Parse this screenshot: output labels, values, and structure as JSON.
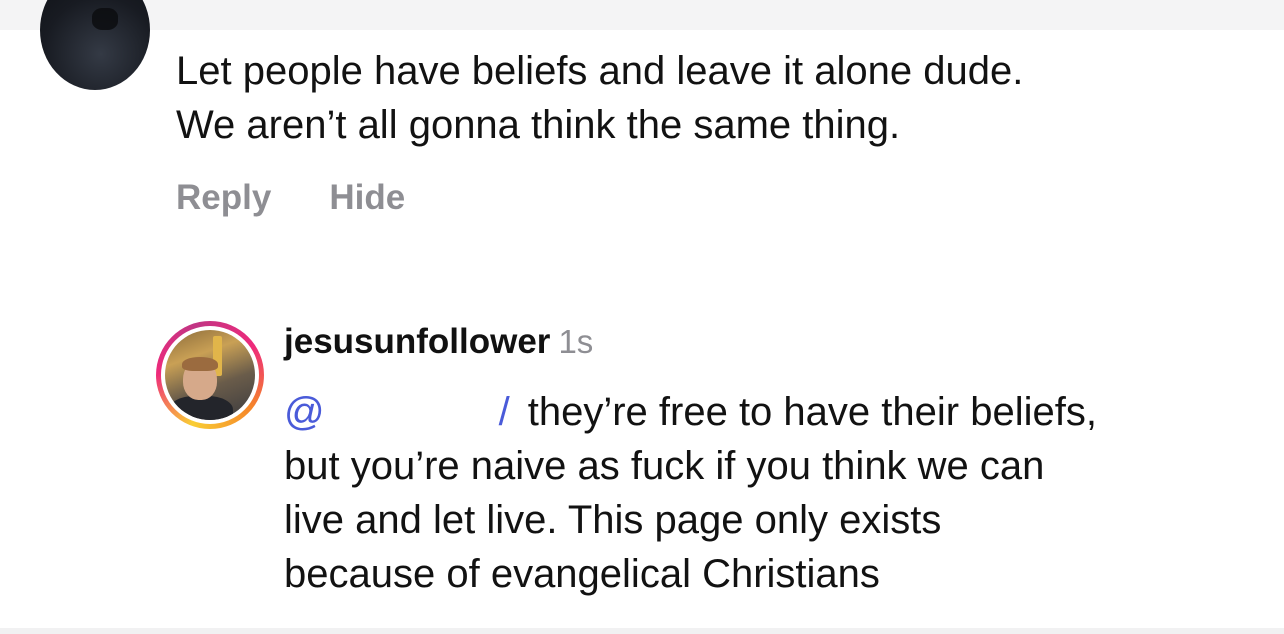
{
  "parent_comment": {
    "avatar": "user-avatar",
    "lines": [
      "Let people have beliefs and leave it alone dude.",
      "We aren’t all gonna think the same thing."
    ],
    "actions": {
      "reply_label": "Reply",
      "hide_label": "Hide"
    }
  },
  "reply": {
    "avatar": "user-avatar-with-story-ring",
    "username": "jesusunfollower",
    "timestamp": "1s",
    "mention_prefix": "@",
    "mention_visible_end": "/",
    "first_line_text": "they’re free to have their beliefs,",
    "lines": [
      "but you’re naive as fuck if you think we can",
      "live and let live. This page only exists",
      "because of evangelical Christians"
    ]
  },
  "colors": {
    "mention": "#4a5bd9",
    "muted": "#8e8e93",
    "text": "#121212"
  }
}
